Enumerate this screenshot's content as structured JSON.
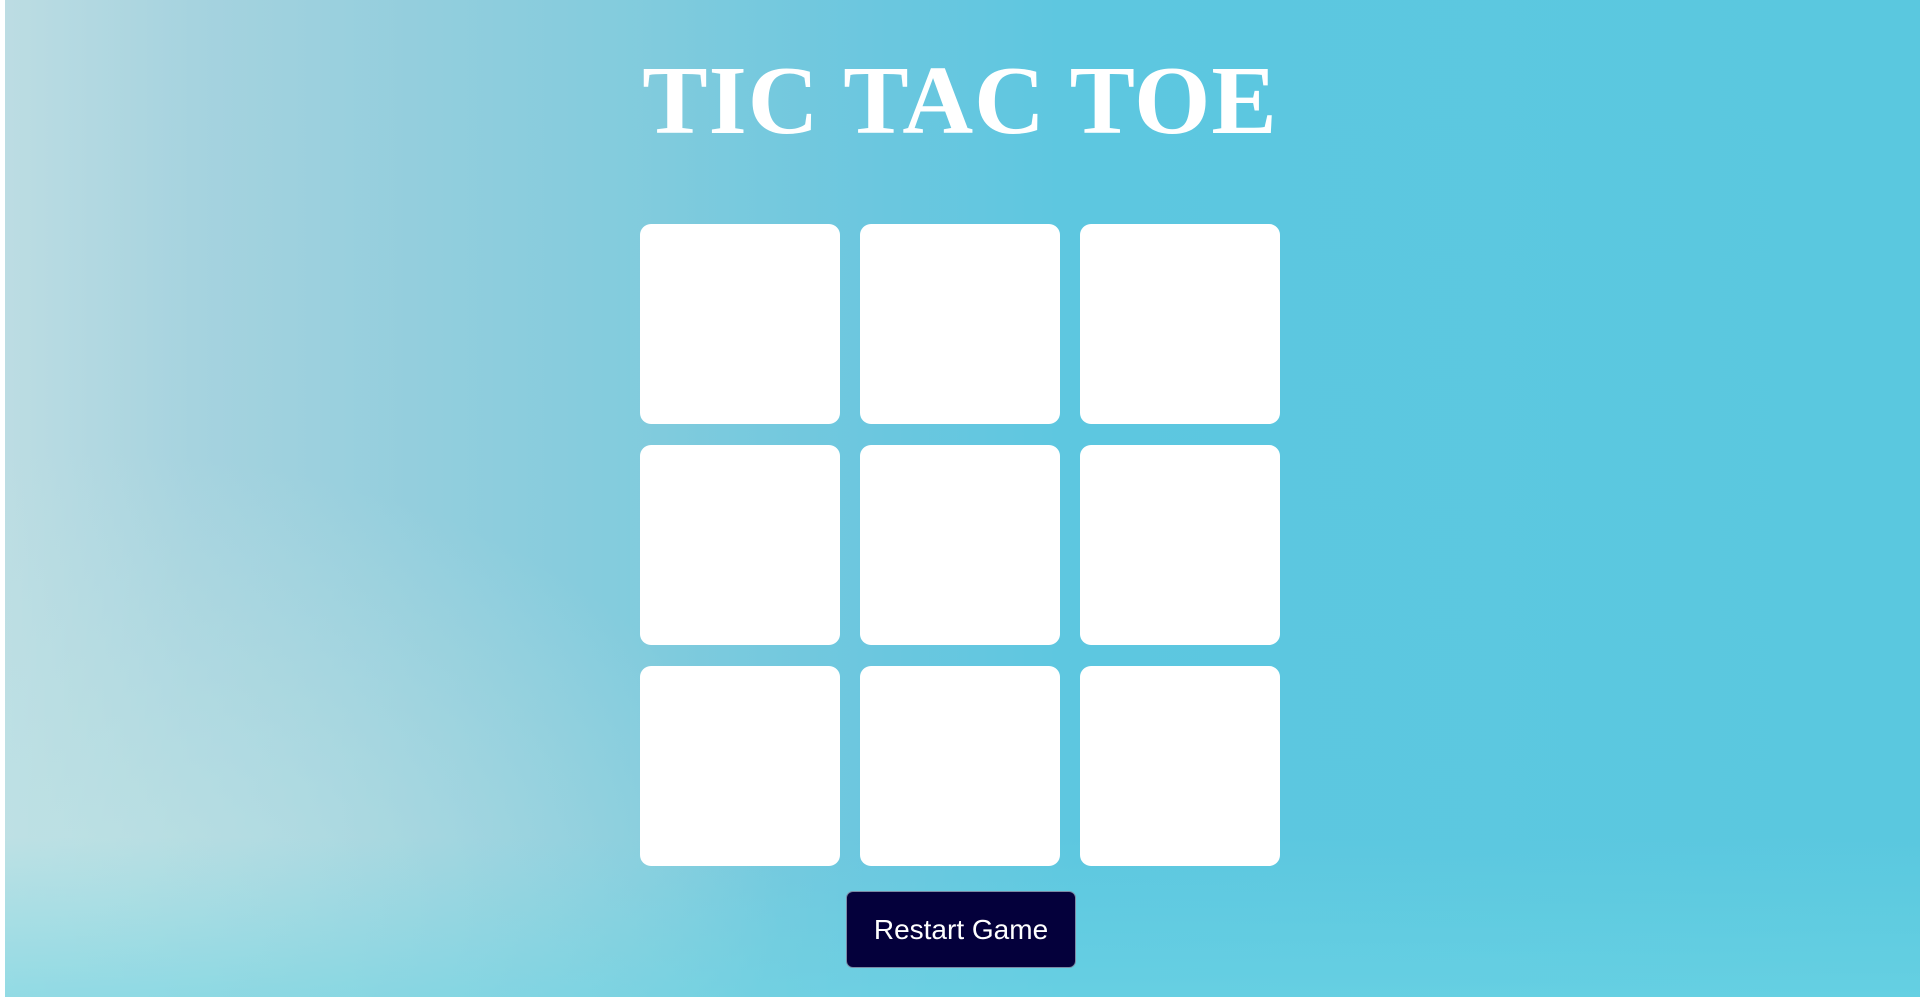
{
  "game": {
    "title": "TIC TAC TOE",
    "board": [
      {
        "mark": ""
      },
      {
        "mark": ""
      },
      {
        "mark": ""
      },
      {
        "mark": ""
      },
      {
        "mark": ""
      },
      {
        "mark": ""
      },
      {
        "mark": ""
      },
      {
        "mark": ""
      },
      {
        "mark": ""
      }
    ],
    "restart_label": "Restart Game"
  },
  "colors": {
    "background_left": "#bddde3",
    "background_right": "#5ac8df",
    "cell": "#ffffff",
    "title": "#ffffff",
    "button_bg": "#04003b",
    "button_text": "#ffffff"
  }
}
